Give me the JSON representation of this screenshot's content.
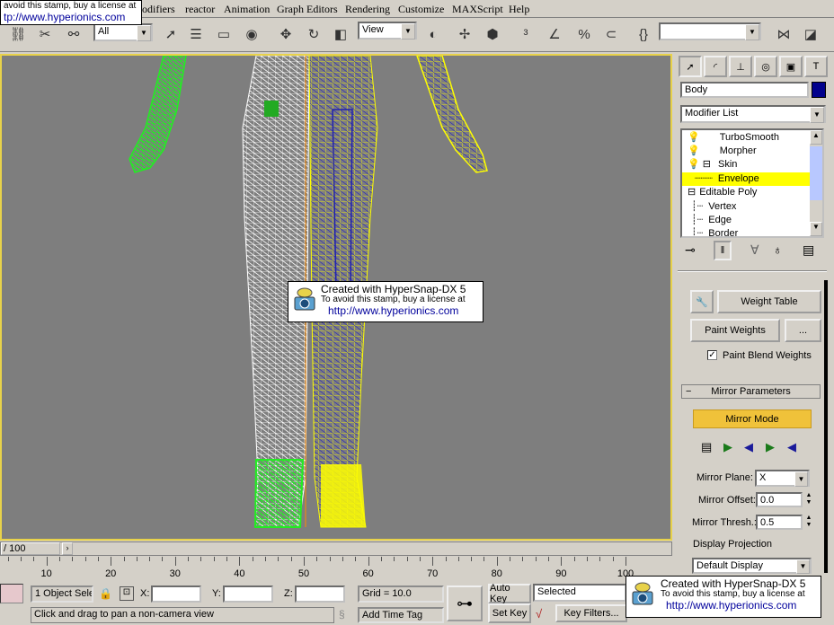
{
  "menu": [
    "odifiers",
    "reactor",
    "Animation",
    "Graph Editors",
    "Rendering",
    "Customize",
    "MAXScript",
    "Help"
  ],
  "toolbar": {
    "filter_value": "All",
    "refcoord_value": "View",
    "icons": [
      "link-icon",
      "unlink-icon",
      "bind-icon",
      "select-icon",
      "select-by-name-icon",
      "rect-select-icon",
      "window-crossing-icon",
      "move-icon",
      "rotate-icon",
      "scale-icon",
      "pivot-icon",
      "mirror-icon",
      "align-icon",
      "snap-icon",
      "angle-snap-icon",
      "percent-snap-icon",
      "spinner-snap-icon",
      "named-selection-icon",
      "curve-editor-icon",
      "schematic-icon"
    ]
  },
  "stamp": {
    "line1": "Created with HyperSnap-DX 5",
    "line2": "To avoid this stamp, buy a license at",
    "link": "http://www.hyperionics.com",
    "topleft_line1": "avoid this stamp, buy a license at",
    "topleft_link": "tp://www.hyperionics.com"
  },
  "panel": {
    "object_name": "Body",
    "object_color": "#00008c",
    "modifier_list": "Modifier List",
    "stack": [
      {
        "label": "TurboSmooth",
        "indent": 1,
        "selected": false
      },
      {
        "label": "Morpher",
        "indent": 1,
        "selected": false
      },
      {
        "label": "Skin",
        "indent": 1,
        "selected": false
      },
      {
        "label": "Envelope",
        "indent": 2,
        "selected": true
      },
      {
        "label": "Editable Poly",
        "indent": 0,
        "selected": false
      },
      {
        "label": "Vertex",
        "indent": 2,
        "selected": false
      },
      {
        "label": "Edge",
        "indent": 2,
        "selected": false
      },
      {
        "label": "Border",
        "indent": 2,
        "selected": false
      }
    ],
    "weight_table": "Weight Table",
    "paint_weights": "Paint Weights",
    "ellipsis": "...",
    "paint_blend": "Paint Blend Weights",
    "mirror_params": "Mirror Parameters",
    "mirror_mode": "Mirror Mode",
    "mirror_plane_label": "Mirror Plane:",
    "mirror_plane_value": "X",
    "mirror_offset_label": "Mirror Offset:",
    "mirror_offset_value": "0.0",
    "mirror_thresh_label": "Mirror Thresh.:",
    "mirror_thresh_value": "0.5",
    "display_projection_label": "Display Projection",
    "display_projection_value": "Default Display"
  },
  "timeline": {
    "slider_text": "/ 100",
    "ticks": [
      "10",
      "20",
      "30",
      "40",
      "50",
      "60",
      "70",
      "80",
      "90",
      "100"
    ]
  },
  "status": {
    "selection": "1 Object Sele",
    "x_label": "X:",
    "y_label": "Y:",
    "z_label": "Z:",
    "grid": "Grid = 10.0",
    "auto_key": "Auto Key",
    "selected": "Selected",
    "set_key": "Set Key",
    "key_filters": "Key Filters...",
    "prompt": "Click and drag to pan a non-camera view",
    "add_time_tag": "Add Time Tag"
  },
  "colors": {
    "viewport_bg": "#7e7e7e",
    "active_border": "#e8d24a",
    "selection_yellow": "#ffff00",
    "mirror_mode_bg": "#f0c23a"
  }
}
